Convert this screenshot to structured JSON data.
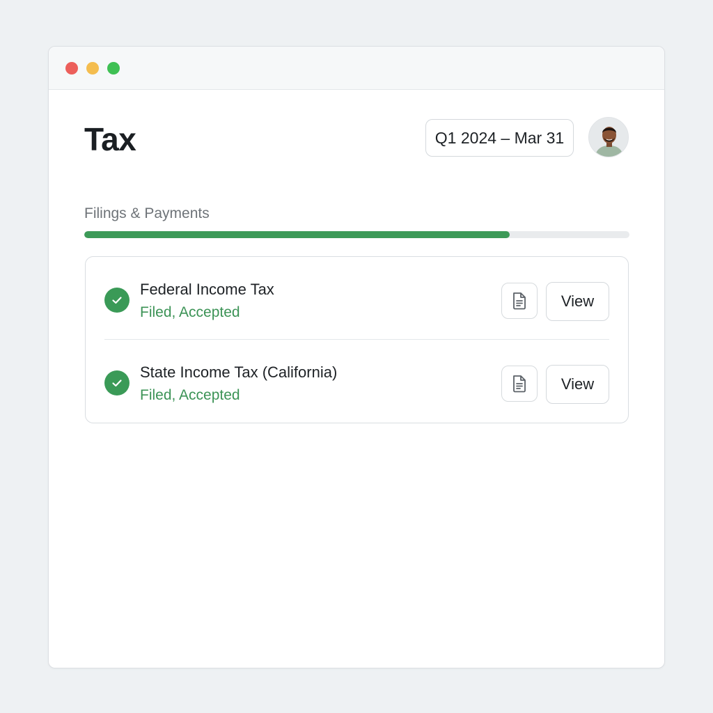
{
  "window": {
    "controls": {
      "close_color": "#ec5f5b",
      "minimize_color": "#f4bd4f",
      "maximize_color": "#3fc054"
    }
  },
  "header": {
    "title": "Tax",
    "period_label": "Q1 2024 – Mar 31",
    "avatar_icon": "user-avatar"
  },
  "section": {
    "label": "Filings & Payments",
    "progress": 0.78,
    "progress_color": "#3d9a58"
  },
  "filings": [
    {
      "title": "Federal Income Tax",
      "status": "Filed, Accepted",
      "status_icon": "check-circle-icon",
      "doc_icon": "document-icon",
      "view_label": "View"
    },
    {
      "title": "State Income Tax (California)",
      "status": "Filed, Accepted",
      "status_icon": "check-circle-icon",
      "doc_icon": "document-icon",
      "view_label": "View"
    }
  ],
  "colors": {
    "accent_green": "#3a9a57",
    "status_text": "#3c9356"
  }
}
